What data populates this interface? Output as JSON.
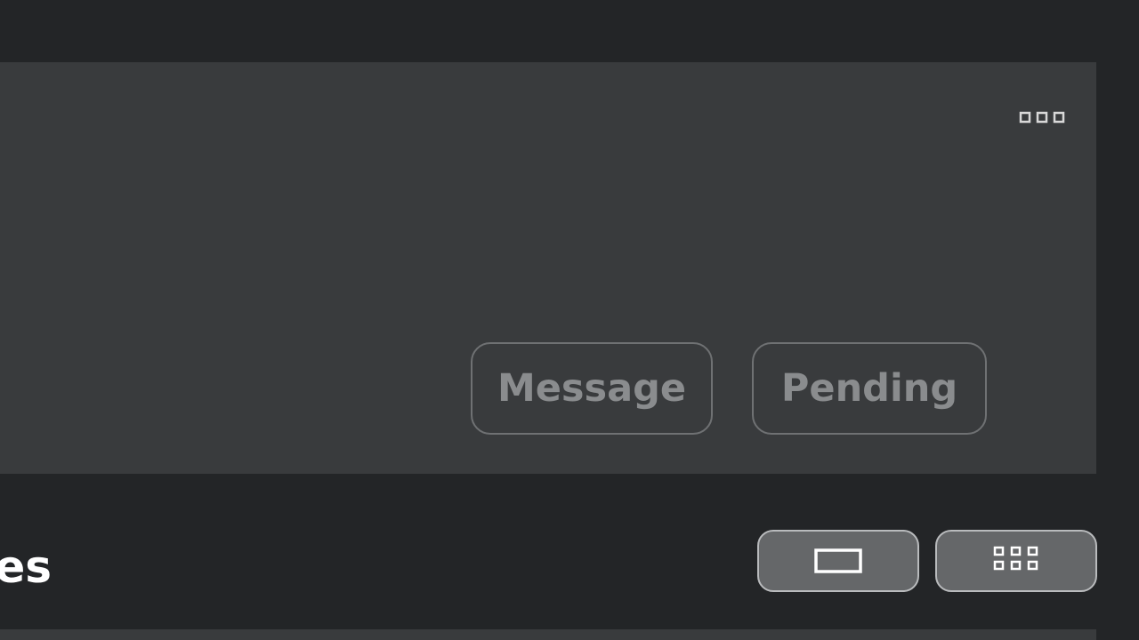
{
  "profile_header": {
    "more_icon": "more-dots-icon",
    "actions": {
      "message_label": "Message",
      "pending_label": "Pending"
    }
  },
  "section": {
    "title_visible": "es"
  },
  "view_toggles": {
    "single_icon": "single-card-view-icon",
    "grid_icon": "grid-view-icon"
  },
  "colors": {
    "page_background": "#232527",
    "panel_background": "#393b3d",
    "button_text_muted": "#8a8c8e",
    "toggle_background": "#656769"
  }
}
